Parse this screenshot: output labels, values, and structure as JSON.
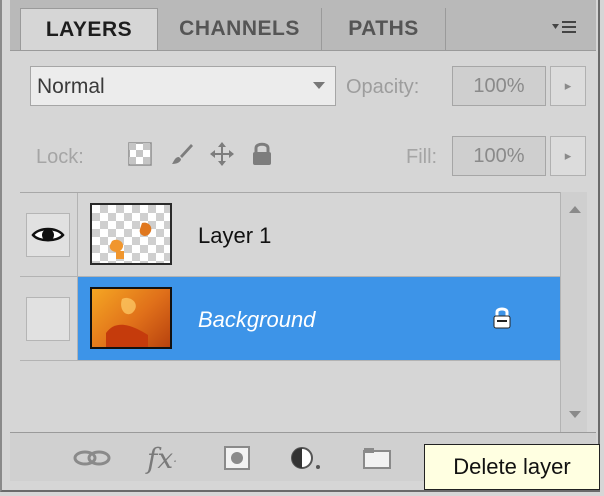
{
  "tabs": [
    {
      "label": "LAYERS",
      "active": true
    },
    {
      "label": "CHANNELS",
      "active": false
    },
    {
      "label": "PATHS",
      "active": false
    }
  ],
  "blend_mode": {
    "value": "Normal"
  },
  "opacity": {
    "label": "Opacity:",
    "value": "100%"
  },
  "lock": {
    "label": "Lock:"
  },
  "fill": {
    "label": "Fill:",
    "value": "100%"
  },
  "layers": [
    {
      "name": "Layer 1",
      "visible": true,
      "selected": false,
      "locked": false
    },
    {
      "name": "Background",
      "visible": false,
      "selected": true,
      "locked": true
    }
  ],
  "tooltip": {
    "text": "Delete layer"
  },
  "icons": {
    "panel_menu": "panel-menu-icon",
    "lock_transparent": "lock-transparent-pixels-icon",
    "lock_image": "brush-icon",
    "lock_position": "move-icon",
    "lock_all": "lock-icon",
    "toolbar": [
      "link-icon",
      "fx-icon",
      "mask-icon",
      "adjustment-icon",
      "folder-icon"
    ]
  },
  "colors": {
    "selection": "#3d94e8",
    "panel": "#d6d6d6",
    "tooltip_bg": "#ffffe1"
  }
}
